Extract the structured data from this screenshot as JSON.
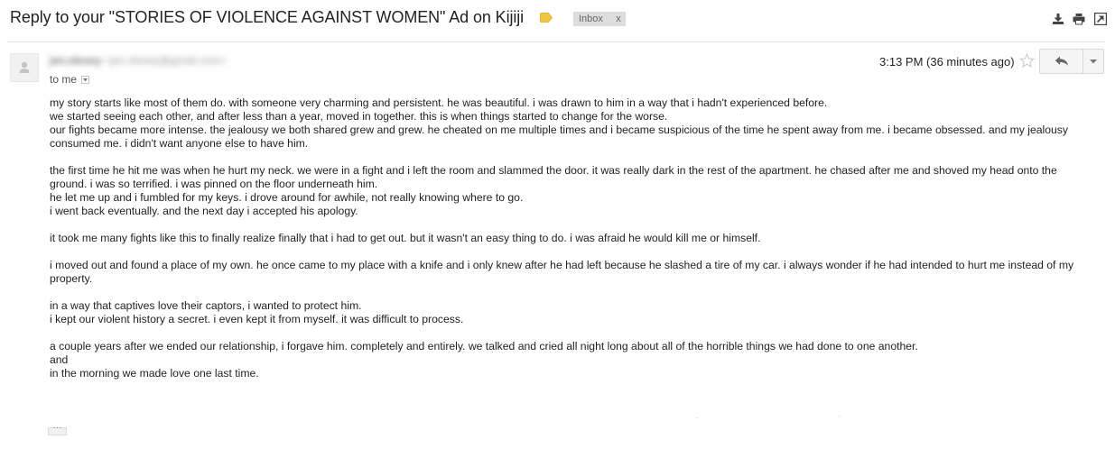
{
  "subject": "Reply to your \"STORIES OF VIOLENCE AGAINST WOMEN\" Ad on Kijiji",
  "labels": [
    {
      "name": "Inbox",
      "remove": "x"
    }
  ],
  "toolbar_icons": [
    "download-icon",
    "print-icon",
    "new-window-icon"
  ],
  "colors": {
    "label_tag": "#f4c542",
    "label_bg": "#dddddd",
    "text": "#222222"
  },
  "message": {
    "sender_name": "jen.elesey",
    "sender_email": "<jen.elesey@gmail.com>",
    "recipient": "to me",
    "time": "3:13 PM (36 minutes ago)",
    "paragraphs": [
      "my story starts like most of them do. with someone very charming and persistent.   he was beautiful.  i was drawn to him in a way that i hadn't experienced before.\nwe started seeing each other, and after less than a year, moved in together.  this is when things started to change for the worse.\nour fights became more intense.  the jealousy we both shared grew and grew.  he cheated on me multiple times and i became suspicious of the time he spent away from me.  i became obsessed.  and my jealousy consumed me.  i didn't want anyone else to have him.",
      "the first time he hit me was when he hurt my neck.  we were in a fight and i left the room and slammed the door.  it was really dark in the rest of the apartment.  he chased after me and shoved my head onto the ground.  i was so terrified.  i was pinned on the floor underneath him.\nhe let me up and i fumbled for my keys.  i drove around for awhile, not really knowing where to go.\ni went back eventually.  and the next day i accepted his apology.",
      "it took me many fights like this to finally realize finally that i had to get out.  but it wasn't an easy thing to do.   i was afraid he would kill me or himself.",
      "i moved out and found a place of my own.  he once came to my place with a knife and i only knew after he had left because he slashed a tire of my car.  i always wonder if he had intended to hurt me instead of my property.",
      "in a way that captives love their captors, i wanted to protect him.\ni kept our violent history a secret.  i even kept it from myself.  it was difficult to process.",
      "a couple years after we ended our relationship, i forgave him.  completely and entirely.  we talked and cried all night long about all of the horrible things we had done to one another.\nand\nin the morning we made love one last time."
    ],
    "trimmed_indicator": "···"
  }
}
